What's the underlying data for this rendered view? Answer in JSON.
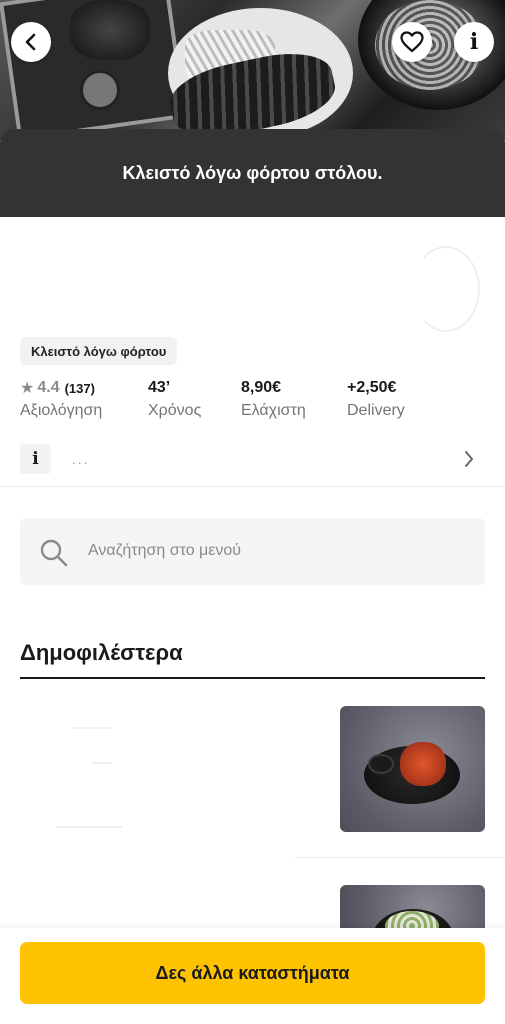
{
  "header": {
    "back_icon": "chevron-left-icon",
    "favorite_icon": "heart-outline-icon",
    "info_icon": "info-icon",
    "info_glyph": "i"
  },
  "banner": {
    "text": "Κλειστό λόγω φόρτου στόλου."
  },
  "store": {
    "status_chip": "Κλειστό λόγω φόρτου",
    "stats": {
      "rating": {
        "value": "4.4",
        "count": "(137)",
        "label": "Αξιολόγηση"
      },
      "time": {
        "value": "43’",
        "label": "Χρόνος"
      },
      "minimum": {
        "value": "8,90€",
        "label": "Ελάχιστη"
      },
      "delivery": {
        "value": "+2,50€",
        "label": "Delivery"
      }
    },
    "info_row": {
      "glyph": "i",
      "text": "..."
    }
  },
  "search": {
    "placeholder": "Αναζήτηση στο μενού"
  },
  "menu": {
    "section_title": "Δημοφιλέστερα"
  },
  "footer": {
    "cta_label": "Δες άλλα καταστήματα"
  },
  "colors": {
    "accent": "#fdc300",
    "banner_bg": "#333333",
    "muted_text": "#757575"
  }
}
